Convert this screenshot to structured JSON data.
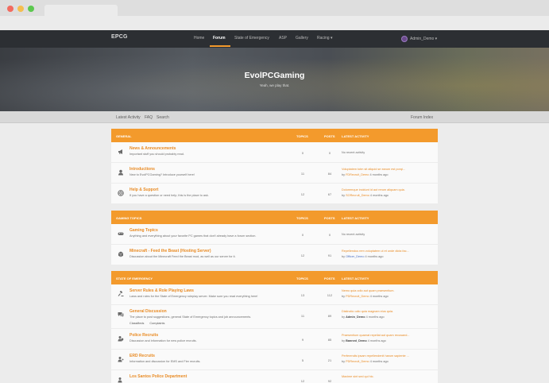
{
  "nav": {
    "brand": "EPCG",
    "items": [
      "Home",
      "Forum",
      "State of Emergency",
      "ASP",
      "Gallery",
      "Racing ▾"
    ],
    "active_index": 1,
    "user": "Admin_Demo ▾"
  },
  "hero": {
    "title": "EvolPCGaming",
    "subtitle": "Yeah, we play that."
  },
  "subnav": {
    "links": [
      "Latest Activity",
      "FAQ",
      "Search"
    ],
    "right": "Forum Index"
  },
  "columns": {
    "topics": "TOPICS",
    "posts": "POSTS",
    "last": "LATEST ACTIVITY"
  },
  "sections": [
    {
      "name": "GENERAL",
      "forums": [
        {
          "icon": "megaphone-icon",
          "title": "News & Announcements",
          "desc": "Important stuff you should probably read.",
          "topics": "0",
          "posts": "0",
          "last_title": "No recent activity",
          "last_by": "",
          "last_time": ""
        },
        {
          "icon": "user-icon",
          "title": "Introductions",
          "desc": "New to EvolPCGaming? Introduce yourself here!",
          "topics": "11",
          "posts": "84",
          "last_title": "Voluptatem totm sit aliquid se earum est porqi...",
          "last_by": "FDRecruit_Demo",
          "last_time": "4 months ago"
        },
        {
          "icon": "lifebuoy-icon",
          "title": "Help & Support",
          "desc": "If you have a question or need help, this is the place to ask.",
          "topics": "12",
          "posts": "67",
          "last_title": "Doloremque incidunt id aut rerum aliquam quia.",
          "last_by": "SORecruit_Demo",
          "last_time": "4 months ago"
        }
      ]
    },
    {
      "name": "GAMING TOPICS",
      "forums": [
        {
          "icon": "gamepad-icon",
          "title": "Gaming Topics",
          "desc": "Anything and everything about your favorite PC games that don't already have a forum section.",
          "topics": "0",
          "posts": "0",
          "last_title": "No recent activity",
          "last_by": "",
          "last_time": ""
        },
        {
          "icon": "cube-icon",
          "title": "Minecraft - Feed the Beast (Hosting Server)",
          "desc": "Discussion about the Minecraft Feed the Beast mod, as well as our server for it.",
          "topics": "12",
          "posts": "91",
          "last_title": "Repellendus rem voluptatem ut et unde dicta fac...",
          "last_by": "Officer_Demo",
          "last_time": "4 months ago"
        }
      ]
    },
    {
      "name": "STATE OF EMERGENCY",
      "forums": [
        {
          "icon": "gavel-icon",
          "title": "Server Rules & Role Playing Laws",
          "desc": "Laws and rules for the State of Emergency roleplay server. Make sure you read everything here!",
          "topics": "13",
          "posts": "112",
          "last_title": "Nemo quia odio aut quam praesentium.",
          "last_by": "PDRecruit_Demo",
          "last_time": "4 months ago"
        },
        {
          "icon": "comments-icon",
          "title": "General Discussion",
          "desc": "The place to post suggestions, general State of Emergency topics and job announcements.",
          "sub": [
            "Classifieds",
            "Complaints"
          ],
          "topics": "11",
          "posts": "89",
          "last_title": "Distinctio odio quia magnam eius quia.",
          "last_by": "Admin_Demo",
          "last_time": "4 months ago"
        },
        {
          "icon": "police-icon",
          "title": "Police Recruits",
          "desc": "Discussion and information for new police recruits.",
          "topics": "9",
          "posts": "85",
          "last_title": "Praesentium quaerat repellat aut quam recusand...",
          "last_by": "Banned_Demo",
          "last_time": "4 months ago"
        },
        {
          "icon": "ems-icon",
          "title": "ERD Recruits",
          "desc": "Information and discussion for EMS and Fire recruits.",
          "topics": "5",
          "posts": "21",
          "last_title": "Perferendis ipsam repellendenit harum sapiente ...",
          "last_by": "PDRecruit_Demo",
          "last_time": "4 months ago"
        },
        {
          "icon": "badge-icon",
          "title": "Los Santos Police Department",
          "desc": "",
          "topics": "12",
          "posts": "92",
          "last_title": "Maxime sint sed qui hic.",
          "last_by": "",
          "last_time": ""
        }
      ]
    }
  ],
  "colors": {
    "accent": "#f39a2c",
    "link": "#e98b24",
    "navbar": "#2c2f33"
  }
}
